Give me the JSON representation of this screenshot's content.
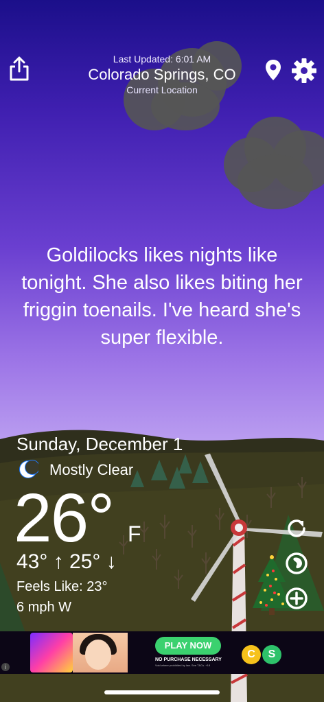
{
  "header": {
    "last_updated": "Last Updated: 6:01 AM",
    "city": "Colorado Springs, CO",
    "location_label": "Current Location"
  },
  "quote": "Goldilocks likes nights like tonight. She also likes biting her friggin toenails. I've heard she's super flexible.",
  "weather": {
    "date": "Sunday, December 1",
    "condition": "Mostly Clear",
    "condition_icon": "crescent-moon-icon",
    "temperature": "26°",
    "unit": "F",
    "high_low": "43° ↑ 25° ↓",
    "feels_like": "Feels Like: 23°",
    "wind": "6 mph W"
  },
  "controls": {
    "share_icon": "share-icon",
    "location_icon": "location-pin-icon",
    "settings_icon": "gear-icon",
    "refresh_icon": "refresh-icon",
    "radar_icon": "radar-icon",
    "add_icon": "add-location-icon"
  },
  "ad": {
    "cta": "PLAY NOW",
    "disclaimer": "NO PURCHASE NECESSARY",
    "fine_print": "Void where prohibited by law. See T&Cs. +18",
    "coin_c": "C",
    "coin_s": "S",
    "info": "i"
  },
  "colors": {
    "sky_top": "#1b0f8a",
    "sky_bottom": "#b99cf0",
    "hills": "#3b3a1e",
    "ad_cta": "#3bd16f"
  }
}
